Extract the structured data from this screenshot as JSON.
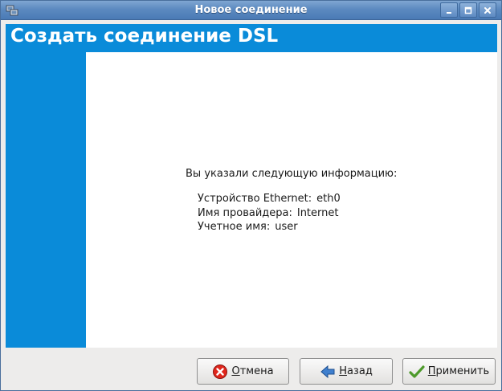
{
  "window": {
    "title": "Новое соединение",
    "icons": [
      "network-app-icon",
      "minimize-icon",
      "maximize-icon",
      "close-icon"
    ]
  },
  "banner": {
    "title": "Создать соединение DSL",
    "color": "#0a8bd9"
  },
  "summary": {
    "heading": "Вы указали следующую информацию:",
    "rows": [
      {
        "label": "Устройство Ethernet:",
        "value": "eth0"
      },
      {
        "label": "Имя провайдера:",
        "value": "Internet"
      },
      {
        "label": "Учетное имя:",
        "value": "user"
      }
    ]
  },
  "buttons": {
    "cancel": {
      "mnemonic": "О",
      "rest": "тмена",
      "icon": "cancel-icon"
    },
    "back": {
      "mnemonic": "Н",
      "rest": "азад",
      "icon": "back-arrow-icon"
    },
    "apply": {
      "mnemonic": "П",
      "rest": "рименить",
      "icon": "checkmark-icon"
    }
  }
}
